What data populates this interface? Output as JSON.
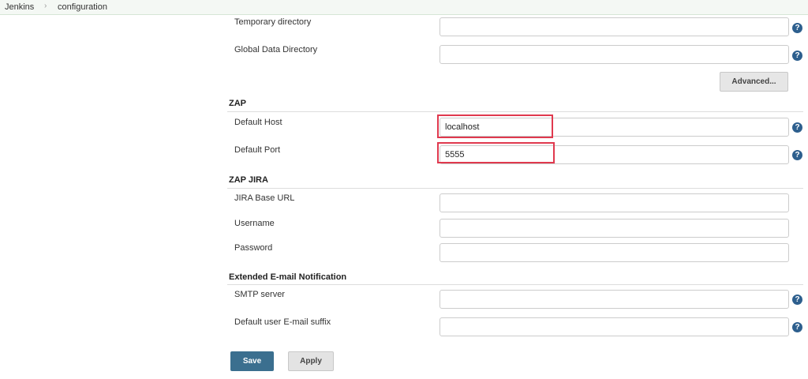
{
  "breadcrumb": {
    "root": "Jenkins",
    "current": "configuration"
  },
  "general": {
    "temp_dir_label": "Temporary directory",
    "global_data_label": "Global Data Directory",
    "advanced_label": "Advanced..."
  },
  "zap": {
    "title": "ZAP",
    "host_label": "Default Host",
    "host_value": "localhost",
    "port_label": "Default Port",
    "port_value": "5555"
  },
  "zap_jira": {
    "title": "ZAP JIRA",
    "url_label": "JIRA Base URL",
    "username_label": "Username",
    "password_label": "Password"
  },
  "email": {
    "title": "Extended E-mail Notification",
    "smtp_label": "SMTP server",
    "suffix_label": "Default user E-mail suffix"
  },
  "help_glyph": "?",
  "actions": {
    "save_label": "Save",
    "apply_label": "Apply"
  },
  "colors": {
    "help": "#2d5f8e",
    "highlight": "#e0394e",
    "save": "#3b6f8f"
  }
}
